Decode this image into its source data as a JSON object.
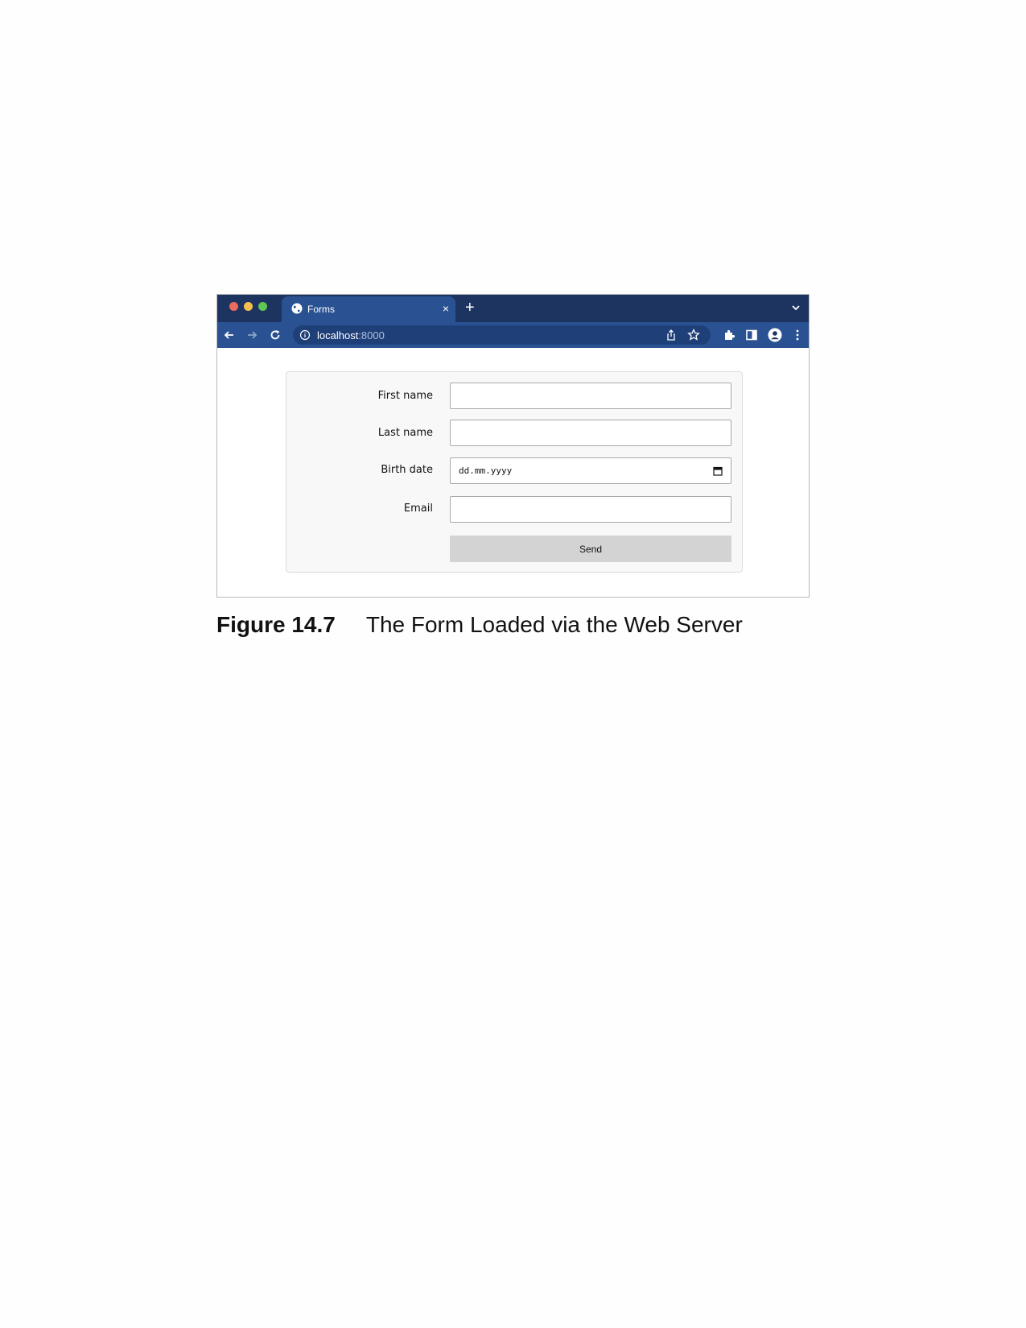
{
  "browser": {
    "tab": {
      "title": "Forms",
      "close_label": "×"
    },
    "new_tab_label": "+",
    "address": {
      "host": "localhost",
      "port": ":8000"
    },
    "colors": {
      "tabbar": "#1d3461",
      "toolbar": "#2a5292",
      "omnibox": "#1f3f78"
    },
    "traffic_lights": [
      "#ed6a5e",
      "#f5bf4f",
      "#61c554"
    ]
  },
  "form": {
    "fields": [
      {
        "label": "First name",
        "value": ""
      },
      {
        "label": "Last name",
        "value": ""
      },
      {
        "label": "Birth date",
        "value": "dd.mm.yyyy"
      },
      {
        "label": "Email",
        "value": ""
      }
    ],
    "submit_label": "Send"
  },
  "caption": {
    "number": "Figure 14.7",
    "text": "The Form Loaded via the Web Server"
  }
}
